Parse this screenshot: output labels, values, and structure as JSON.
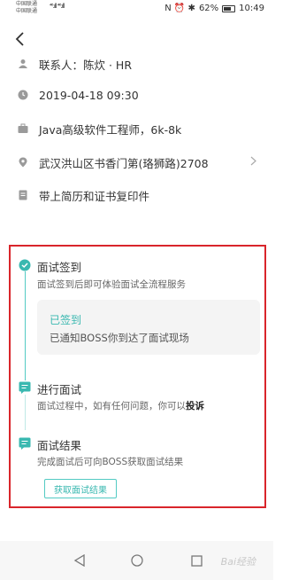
{
  "status_bar": {
    "carrier_1": "中国联通",
    "carrier_2": "中国联通",
    "signal": "⁴⁶.ıll ⁴⁶.ıll",
    "right_icons": "N ⏰ ✱",
    "battery": "62%",
    "time": "10:49"
  },
  "back_label": "<",
  "info": {
    "contact": "联系人：陈炊 · HR",
    "datetime": "2019-04-18 09:30",
    "job": "Java高级软件工程师，6k-8k",
    "address": "武汉洪山区书香门第(珞狮路)2708",
    "bring": "带上简历和证书复印件"
  },
  "steps": [
    {
      "title": "面试签到",
      "desc": "面试签到后即可体验面试全流程服务"
    },
    {
      "title": "进行面试",
      "desc_pre": "面试过程中，如有任何问题，你可以",
      "desc_bold": "投诉"
    },
    {
      "title": "面试结果",
      "desc": "完成面试后可向BOSS获取面试结果"
    }
  ],
  "signed": {
    "title": "已签到",
    "desc": "已通知BOSS你到达了面试现场"
  },
  "result_button": "获取面试结果",
  "nav": {
    "back_icon": "◁",
    "home_icon": "○",
    "recent_icon": "□",
    "watermark": "Bai经验"
  },
  "colors": {
    "accent": "#39b8b0",
    "highlight": "#d9252b"
  }
}
